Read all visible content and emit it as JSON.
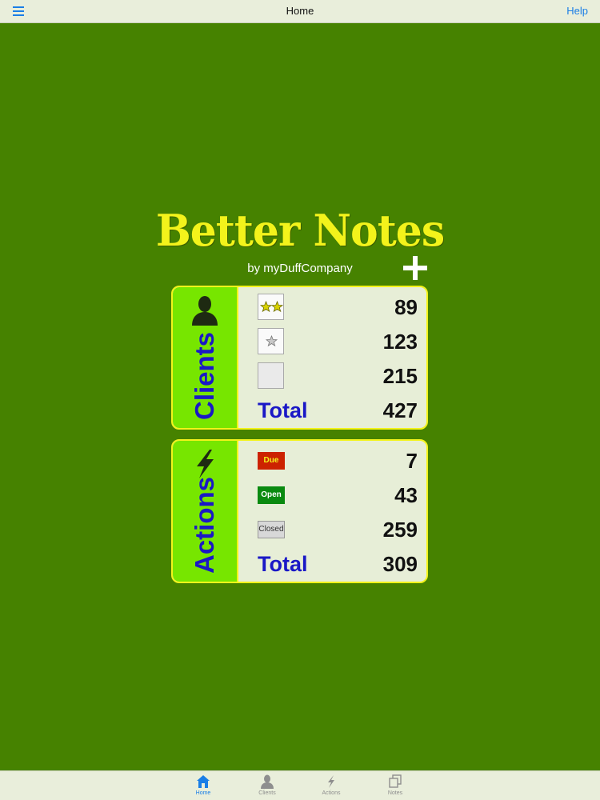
{
  "navbar": {
    "menu_icon": "hamburger-menu-icon",
    "title": "Home",
    "help": "Help"
  },
  "header": {
    "title": "Better Notes",
    "subtitle": "by myDuffCompany",
    "add_icon": "plus-icon"
  },
  "clients": {
    "label": "Clients",
    "icon": "person-icon",
    "rows": [
      {
        "icon": "two-stars-icon",
        "value": "89"
      },
      {
        "icon": "one-star-icon",
        "value": "123"
      },
      {
        "icon": "no-star-icon",
        "value": "215"
      }
    ],
    "total_label": "Total",
    "total_value": "427"
  },
  "actions": {
    "label": "Actions",
    "icon": "lightning-icon",
    "rows": [
      {
        "tag": "Due",
        "value": "7"
      },
      {
        "tag": "Open",
        "value": "43"
      },
      {
        "tag": "Closed",
        "value": "259"
      }
    ],
    "total_label": "Total",
    "total_value": "309"
  },
  "tabs": [
    {
      "label": "Home",
      "icon": "home-icon",
      "active": true
    },
    {
      "label": "Clients",
      "icon": "person-icon",
      "active": false
    },
    {
      "label": "Actions",
      "icon": "lightning-icon",
      "active": false
    },
    {
      "label": "Notes",
      "icon": "notes-stack-icon",
      "active": false
    }
  ],
  "colors": {
    "background": "#468200",
    "title_yellow": "#f3f31b",
    "panel_side_green": "#77e600",
    "label_blue": "#1a18c6",
    "accent_blue": "#1a7ee6"
  }
}
